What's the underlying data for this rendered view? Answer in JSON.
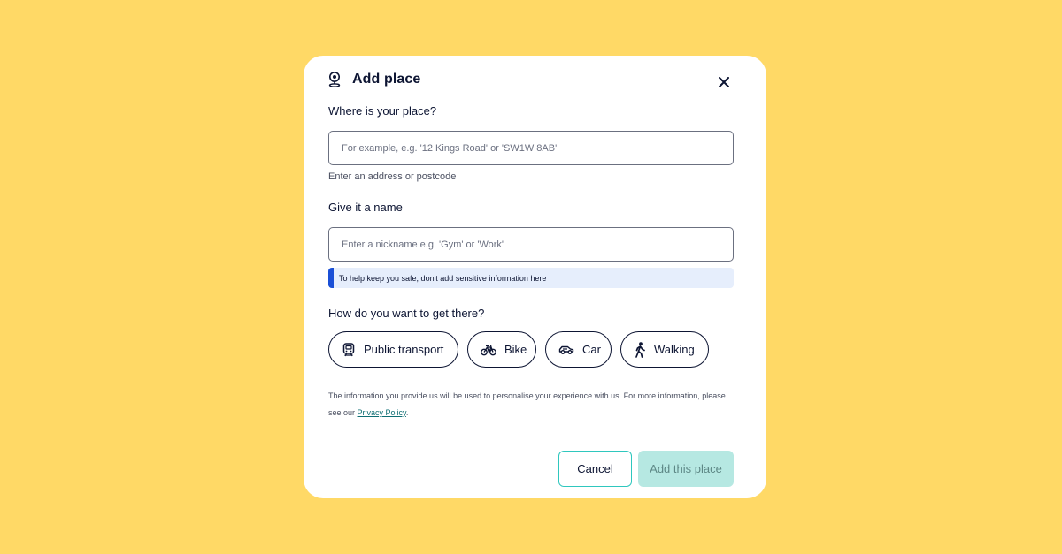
{
  "modal": {
    "title": "Add place",
    "close_label": "Close"
  },
  "place": {
    "label": "Where is your place?",
    "placeholder": "For example, e.g. '12 Kings Road' or 'SW1W 8AB'",
    "value": "",
    "hint": "Enter an address or postcode"
  },
  "name": {
    "label": "Give it a name",
    "placeholder": "Enter a nickname e.g. 'Gym' or 'Work'",
    "value": "",
    "notice": "To help keep you safe, don't add sensitive information here"
  },
  "transport": {
    "label": "How do you want to get there?",
    "options": [
      {
        "label": "Public transport",
        "icon": "train-icon"
      },
      {
        "label": "Bike",
        "icon": "bike-icon"
      },
      {
        "label": "Car",
        "icon": "car-icon"
      },
      {
        "label": "Walking",
        "icon": "walking-icon"
      }
    ]
  },
  "disclaimer": {
    "text_before": "The information you provide us will be used to personalise your experience with us. For more information, please see our ",
    "link": "Privacy Policy",
    "text_after": "."
  },
  "actions": {
    "cancel": "Cancel",
    "add": "Add this place"
  },
  "colors": {
    "background": "#FFD966",
    "primary_text": "#0D1533",
    "accent_teal": "#2FC7BE",
    "disabled_button": "#B6E8E2",
    "notice_bar": "#1A4FD6",
    "notice_bg": "#E6EEFC"
  }
}
